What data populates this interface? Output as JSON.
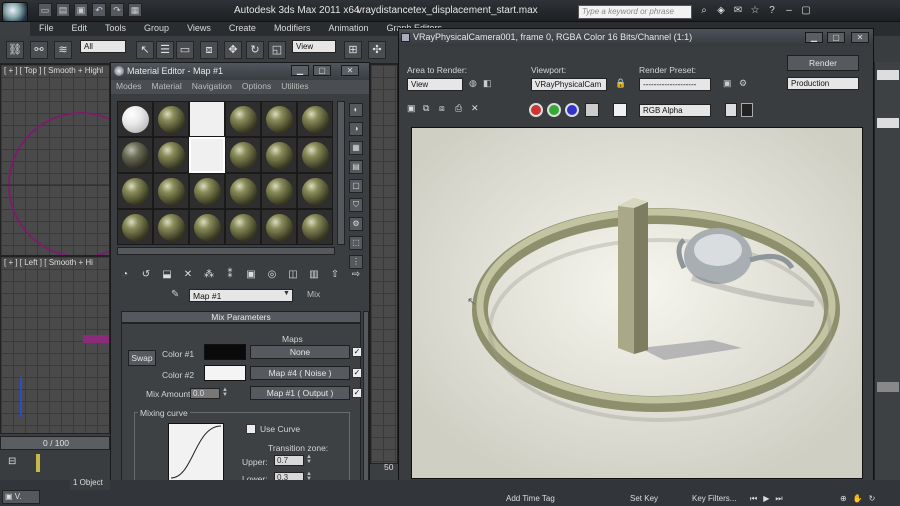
{
  "app": {
    "title": "Autodesk 3ds Max  2011 x64",
    "file": "vraydistancetex_displacement_start.max",
    "search_placeholder": "Type a keyword or phrase"
  },
  "menu": [
    "File",
    "Edit",
    "Tools",
    "Group",
    "Views",
    "Create",
    "Modifiers",
    "Animation",
    "Graph Editors"
  ],
  "toolbar": {
    "selection_filter": "All",
    "ref_coord": "View"
  },
  "viewports": {
    "top": "[ + ] [ Top ] [ Smooth + Highl",
    "left": "[ + ] [ Left ] [ Smooth + Hi"
  },
  "material_editor": {
    "title": "Material Editor - Map #1",
    "menu": [
      "Modes",
      "Material",
      "Navigation",
      "Options",
      "Utilities"
    ],
    "map_name": "Map #1",
    "map_type": "Mix",
    "rollout_title": "Mix Parameters",
    "maps_header": "Maps",
    "swap_label": "Swap",
    "color1_label": "Color #1",
    "color2_label": "Color #2",
    "color1_map": "None",
    "color2_map": "Map #4  ( Noise )",
    "mix_amount_label": "Mix Amount:",
    "mix_amount_value": "0.0",
    "mix_map": "Map #1  ( Output )",
    "mixing_curve_label": "Mixing curve",
    "use_curve_label": "Use Curve",
    "transition_zone_label": "Transition zone:",
    "upper_label": "Upper:",
    "upper_value": "0.7",
    "lower_label": "Lower:",
    "lower_value": "0.3",
    "colors": {
      "color1": "#0a0a0a",
      "color2": "#f4f4f4"
    }
  },
  "render_window": {
    "title": "VRayPhysicalCamera001, frame 0, RGBA Color 16 Bits/Channel (1:1)",
    "area_label": "Area to Render:",
    "area_value": "View",
    "viewport_label": "Viewport:",
    "viewport_value": "VRayPhysicalCam",
    "preset_label": "Render Preset:",
    "preset_value": "--------------------",
    "render_button": "Render",
    "production_value": "Production",
    "channel_value": "RGB Alpha"
  },
  "timeline": {
    "frame_counter": "0 / 100",
    "tick": "50"
  },
  "status": {
    "objects": "1 Object",
    "add_time_tag": "Add Time Tag",
    "set_key": "Set Key",
    "key_filters": "Key Filters..."
  }
}
